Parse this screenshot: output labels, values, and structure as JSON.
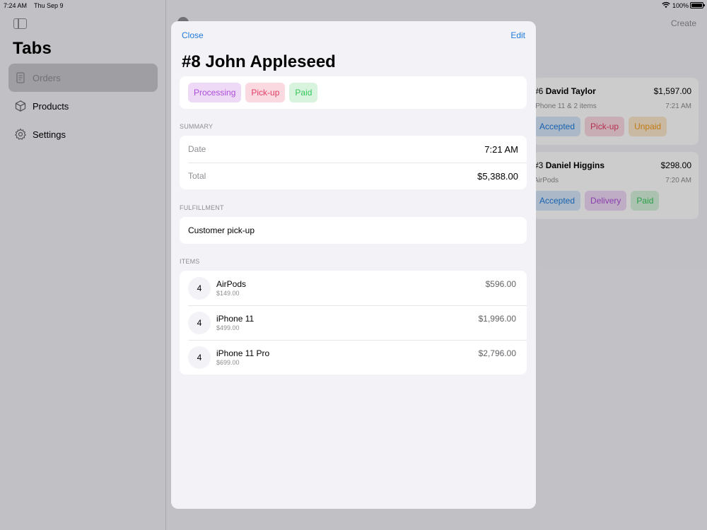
{
  "status_bar": {
    "time": "7:24 AM",
    "date": "Thu Sep 9",
    "battery": "100%"
  },
  "sidebar": {
    "title": "Tabs",
    "items": [
      {
        "label": "Orders",
        "icon": "orders-icon"
      },
      {
        "label": "Products",
        "icon": "cube-icon"
      },
      {
        "label": "Settings",
        "icon": "gear-icon"
      }
    ]
  },
  "main": {
    "create_label": "Create",
    "orders": [
      {
        "number": "#6",
        "name": "David Taylor",
        "price": "$1,597.00",
        "summary": "iPhone 11 & 2 items",
        "time": "7:21 AM",
        "tags": [
          {
            "label": "Accepted",
            "color": "#1f7ad9"
          },
          {
            "label": "Pick-up",
            "color": "#e23d63"
          },
          {
            "label": "Unpaid",
            "color": "#f09a1b"
          }
        ]
      },
      {
        "number": "#3",
        "name": "Daniel Higgins",
        "price": "$298.00",
        "summary": "AirPods",
        "time": "7:20 AM",
        "tags": [
          {
            "label": "Accepted",
            "color": "#1f7ad9"
          },
          {
            "label": "Delivery",
            "color": "#ad4ed8"
          },
          {
            "label": "Paid",
            "color": "#34c759"
          }
        ]
      }
    ]
  },
  "sheet": {
    "close_label": "Close",
    "edit_label": "Edit",
    "title": "#8 John Appleseed",
    "tags": [
      {
        "label": "Processing",
        "color": "#ad4ed8"
      },
      {
        "label": "Pick-up",
        "color": "#e23d63"
      },
      {
        "label": "Paid",
        "color": "#34c759"
      }
    ],
    "summary": {
      "header": "SUMMARY",
      "date_label": "Date",
      "date_value": "7:21 AM",
      "total_label": "Total",
      "total_value": "$5,388.00"
    },
    "fulfillment": {
      "header": "FULFILLMENT",
      "value": "Customer pick-up"
    },
    "items": {
      "header": "ITEMS",
      "list": [
        {
          "qty": "4",
          "name": "AirPods",
          "unit_price": "$149.00",
          "total": "$596.00"
        },
        {
          "qty": "4",
          "name": "iPhone 11",
          "unit_price": "$499.00",
          "total": "$1,996.00"
        },
        {
          "qty": "4",
          "name": "iPhone 11 Pro",
          "unit_price": "$699.00",
          "total": "$2,796.00"
        }
      ]
    }
  },
  "colors": {
    "accent": "#1f7ad9",
    "background": "#f2f2f7",
    "secondary_text": "#8e8e93"
  }
}
